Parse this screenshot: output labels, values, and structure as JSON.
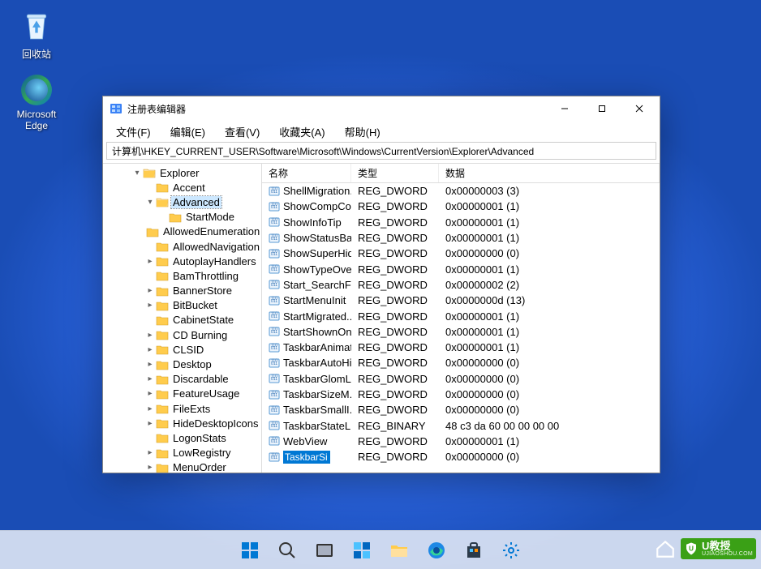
{
  "desktop": {
    "recycle_bin": "回收站",
    "edge": "Microsoft Edge"
  },
  "window": {
    "title": "注册表编辑器",
    "menus": [
      "文件(F)",
      "编辑(E)",
      "查看(V)",
      "收藏夹(A)",
      "帮助(H)"
    ],
    "path": "计算机\\HKEY_CURRENT_USER\\Software\\Microsoft\\Windows\\CurrentVersion\\Explorer\\Advanced",
    "columns": {
      "name": "名称",
      "type": "类型",
      "data": "数据"
    }
  },
  "tree": [
    {
      "indent": 2,
      "exp": "▾",
      "label": "Explorer",
      "open": true
    },
    {
      "indent": 3,
      "exp": "",
      "label": "Accent"
    },
    {
      "indent": 3,
      "exp": "▾",
      "label": "Advanced",
      "open": true,
      "selected": true
    },
    {
      "indent": 4,
      "exp": "",
      "label": "StartMode"
    },
    {
      "indent": 3,
      "exp": "",
      "label": "AllowedEnumeration"
    },
    {
      "indent": 3,
      "exp": "",
      "label": "AllowedNavigation"
    },
    {
      "indent": 3,
      "exp": "▸",
      "label": "AutoplayHandlers"
    },
    {
      "indent": 3,
      "exp": "",
      "label": "BamThrottling"
    },
    {
      "indent": 3,
      "exp": "▸",
      "label": "BannerStore"
    },
    {
      "indent": 3,
      "exp": "▸",
      "label": "BitBucket"
    },
    {
      "indent": 3,
      "exp": "",
      "label": "CabinetState"
    },
    {
      "indent": 3,
      "exp": "▸",
      "label": "CD Burning"
    },
    {
      "indent": 3,
      "exp": "▸",
      "label": "CLSID"
    },
    {
      "indent": 3,
      "exp": "▸",
      "label": "Desktop"
    },
    {
      "indent": 3,
      "exp": "▸",
      "label": "Discardable"
    },
    {
      "indent": 3,
      "exp": "▸",
      "label": "FeatureUsage"
    },
    {
      "indent": 3,
      "exp": "▸",
      "label": "FileExts"
    },
    {
      "indent": 3,
      "exp": "▸",
      "label": "HideDesktopIcons"
    },
    {
      "indent": 3,
      "exp": "",
      "label": "LogonStats"
    },
    {
      "indent": 3,
      "exp": "▸",
      "label": "LowRegistry"
    },
    {
      "indent": 3,
      "exp": "▸",
      "label": "MenuOrder"
    }
  ],
  "values": [
    {
      "name": "ShellMigration...",
      "type": "REG_DWORD",
      "data": "0x00000003 (3)"
    },
    {
      "name": "ShowCompCol...",
      "type": "REG_DWORD",
      "data": "0x00000001 (1)"
    },
    {
      "name": "ShowInfoTip",
      "type": "REG_DWORD",
      "data": "0x00000001 (1)"
    },
    {
      "name": "ShowStatusBar",
      "type": "REG_DWORD",
      "data": "0x00000001 (1)"
    },
    {
      "name": "ShowSuperHid...",
      "type": "REG_DWORD",
      "data": "0x00000000 (0)"
    },
    {
      "name": "ShowTypeOver...",
      "type": "REG_DWORD",
      "data": "0x00000001 (1)"
    },
    {
      "name": "Start_SearchFiles",
      "type": "REG_DWORD",
      "data": "0x00000002 (2)"
    },
    {
      "name": "StartMenuInit",
      "type": "REG_DWORD",
      "data": "0x0000000d (13)"
    },
    {
      "name": "StartMigrated...",
      "type": "REG_DWORD",
      "data": "0x00000001 (1)"
    },
    {
      "name": "StartShownOn...",
      "type": "REG_DWORD",
      "data": "0x00000001 (1)"
    },
    {
      "name": "TaskbarAnimat...",
      "type": "REG_DWORD",
      "data": "0x00000001 (1)"
    },
    {
      "name": "TaskbarAutoHi...",
      "type": "REG_DWORD",
      "data": "0x00000000 (0)"
    },
    {
      "name": "TaskbarGlomL...",
      "type": "REG_DWORD",
      "data": "0x00000000 (0)"
    },
    {
      "name": "TaskbarSizeM...",
      "type": "REG_DWORD",
      "data": "0x00000000 (0)"
    },
    {
      "name": "TaskbarSmallI...",
      "type": "REG_DWORD",
      "data": "0x00000000 (0)"
    },
    {
      "name": "TaskbarStateL...",
      "type": "REG_BINARY",
      "data": "48 c3 da 60 00 00 00 00"
    },
    {
      "name": "WebView",
      "type": "REG_DWORD",
      "data": "0x00000001 (1)"
    }
  ],
  "editing": {
    "name": "TaskbarSi",
    "type": "REG_DWORD",
    "data": "0x00000000 (0)"
  },
  "taskbar": {
    "tray_chevron": "˄",
    "watermark_text": "U教授",
    "watermark_sub": "UJIAOSHOU.COM"
  }
}
